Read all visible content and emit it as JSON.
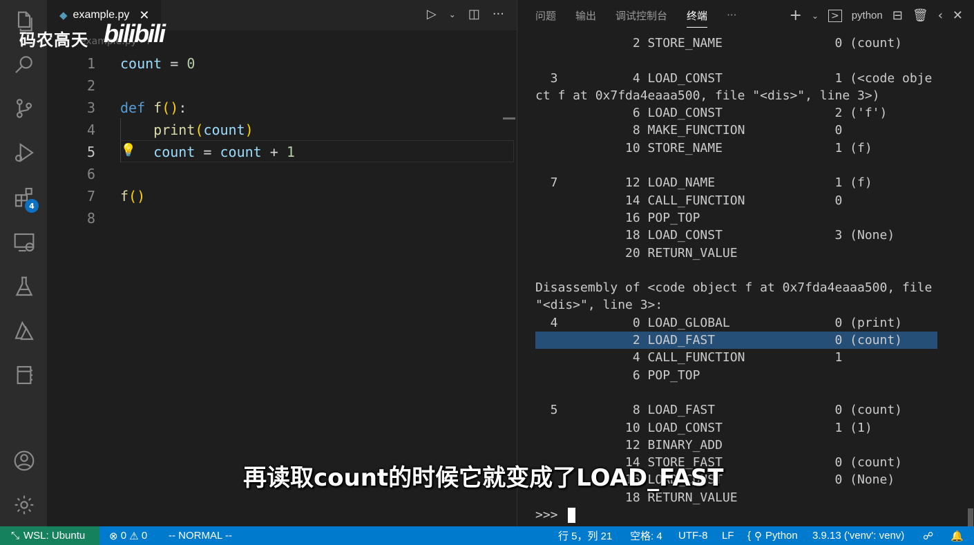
{
  "colors": {
    "activity_bg": "#2c2c2c",
    "status_bg": "#007acc",
    "remote_bg": "#16825d",
    "highlight": "#264f78"
  },
  "activity": {
    "badge": "4",
    "icons": [
      "files-icon",
      "search-icon",
      "source-control-icon",
      "run-debug-icon",
      "extensions-icon",
      "remote-explorer-icon",
      "testing-icon",
      "azure-icon",
      "notebook-icon",
      "account-icon",
      "gear-icon"
    ]
  },
  "watermark": {
    "channel": "码农高天",
    "site": "bilibili"
  },
  "editor": {
    "tab_name": "example.py",
    "tab_close": "✕",
    "breadcrumb": "example.py › f",
    "lines": [
      {
        "num": "1"
      },
      {
        "num": "2"
      },
      {
        "num": "3"
      },
      {
        "num": "4"
      },
      {
        "num": "5"
      },
      {
        "num": "6"
      },
      {
        "num": "7"
      },
      {
        "num": "8"
      }
    ],
    "code": {
      "l1_var": "count",
      "l1_op": " = ",
      "l1_num": "0",
      "l3_kw": "def",
      "l3_fn": "f",
      "l3_open": "(",
      "l3_close": ")",
      "l3_colon": ":",
      "l4_fn": "print",
      "l4_open": "(",
      "l4_var": "count",
      "l4_close": ")",
      "l5_var": "count",
      "l5_op": " = ",
      "l5_var2": "count",
      "l5_op2": " + ",
      "l5_num": "1",
      "l7_fn": "f",
      "l7_paren": "()"
    }
  },
  "panel": {
    "tabs": [
      "问题",
      "输出",
      "调试控制台",
      "终端",
      "···"
    ],
    "active_tab": "终端",
    "shell": "python",
    "terminal_lines": [
      "             2 STORE_NAME               0 (count)",
      "",
      "  3          4 LOAD_CONST               1 (<code obje",
      "ct f at 0x7fda4eaaa500, file \"<dis>\", line 3>)",
      "             6 LOAD_CONST               2 ('f')",
      "             8 MAKE_FUNCTION            0",
      "            10 STORE_NAME               1 (f)",
      "",
      "  7         12 LOAD_NAME                1 (f)",
      "            14 CALL_FUNCTION            0",
      "            16 POP_TOP",
      "            18 LOAD_CONST               3 (None)",
      "            20 RETURN_VALUE",
      "",
      "Disassembly of <code object f at 0x7fda4eaaa500, file",
      "\"<dis>\", line 3>:",
      "  4          0 LOAD_GLOBAL              0 (print)",
      "             2 LOAD_FAST                0 (count)",
      "             4 CALL_FUNCTION            1",
      "             6 POP_TOP",
      "",
      "  5          8 LOAD_FAST                0 (count)",
      "            10 LOAD_CONST               1 (1)",
      "            12 BINARY_ADD",
      "            14 STORE_FAST               0 (count)",
      "            16 LOAD_CONST               0 (None)",
      "            18 RETURN_VALUE"
    ],
    "highlighted_line": 17,
    "prompt": ">>> "
  },
  "subtitle": "再读取count的时候它就变成了LOAD_FAST",
  "status": {
    "remote": "WSL: Ubuntu",
    "errors": "0",
    "warnings": "0",
    "mode": "-- NORMAL --",
    "position": "行 5，列 21",
    "spaces": "空格: 4",
    "encoding": "UTF-8",
    "eol": "LF",
    "language": "Python",
    "interpreter": "3.9.13 ('venv': venv)"
  }
}
